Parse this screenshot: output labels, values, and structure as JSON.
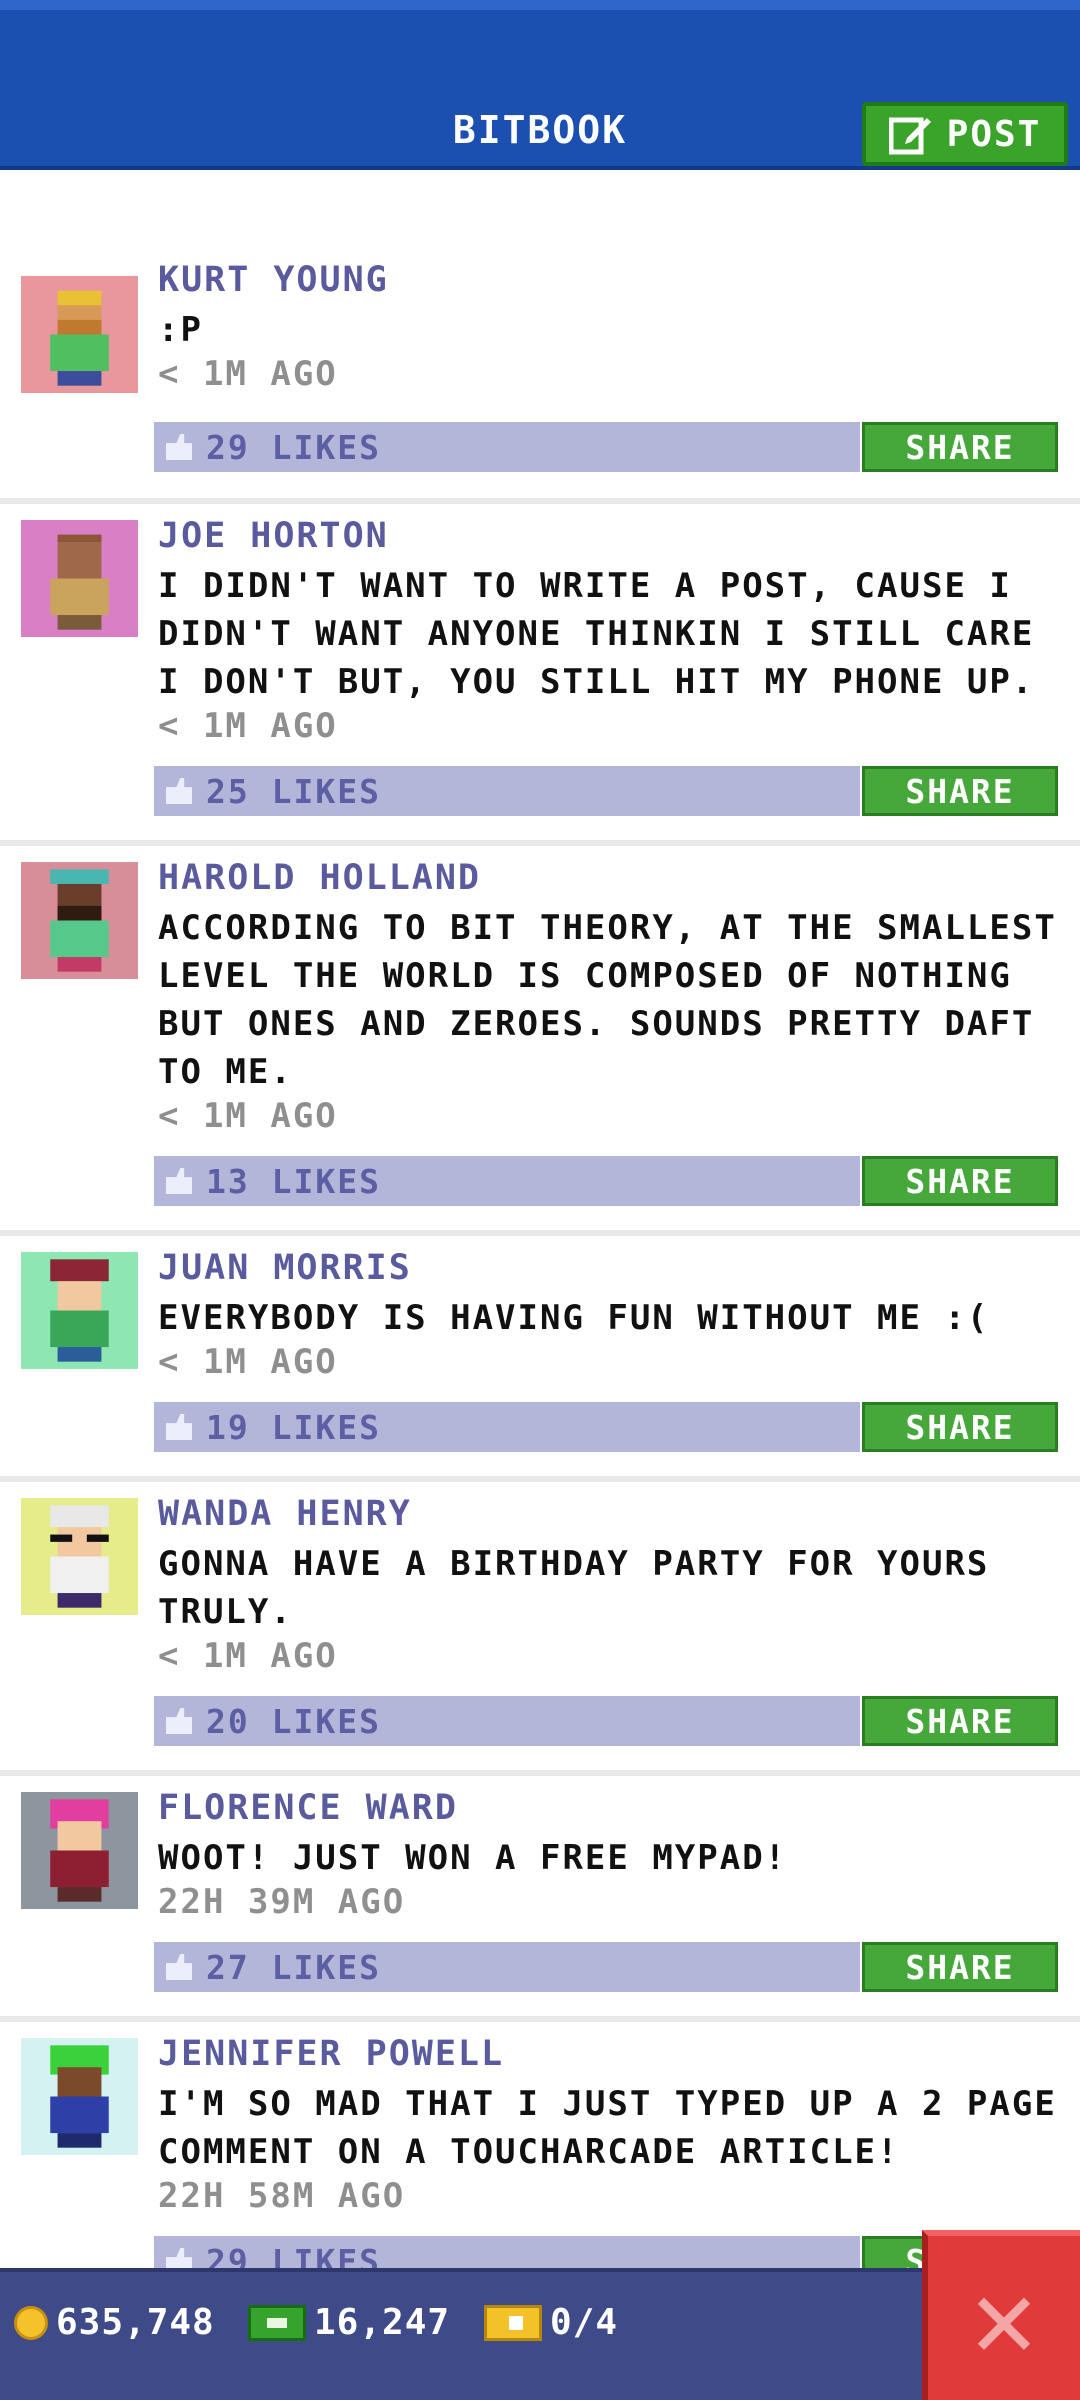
{
  "header": {
    "title": "BITBOOK",
    "post_label": "POST"
  },
  "posts": [
    {
      "name": "KURT YOUNG",
      "text": ":P",
      "time": "< 1M AGO",
      "likes": "29 LIKES",
      "share": "SHARE",
      "avatar_bg": "#e8979d"
    },
    {
      "name": "JOE HORTON",
      "text": "I DIDN'T WANT TO WRITE A POST, CAUSE I DIDN'T WANT ANYONE THINKIN I STILL CARE I DON'T BUT, YOU STILL HIT MY PHONE UP.",
      "time": "< 1M AGO",
      "likes": "25 LIKES",
      "share": "SHARE",
      "avatar_bg": "#d97fc6"
    },
    {
      "name": "HAROLD HOLLAND",
      "text": "ACCORDING TO BIT THEORY, AT THE SMALLEST LEVEL THE WORLD IS COMPOSED OF NOTHING BUT ONES AND ZEROES. SOUNDS PRETTY DAFT TO ME.",
      "time": "< 1M AGO",
      "likes": "13 LIKES",
      "share": "SHARE",
      "avatar_bg": "#d88e98"
    },
    {
      "name": "JUAN MORRIS",
      "text": "EVERYBODY IS HAVING FUN WITHOUT ME :(",
      "time": "< 1M AGO",
      "likes": "19 LIKES",
      "share": "SHARE",
      "avatar_bg": "#8ee6b2"
    },
    {
      "name": "WANDA HENRY",
      "text": "GONNA HAVE A BIRTHDAY PARTY FOR YOURS TRULY.",
      "time": "< 1M AGO",
      "likes": "20 LIKES",
      "share": "SHARE",
      "avatar_bg": "#e6ec8a"
    },
    {
      "name": "FLORENCE WARD",
      "text": "WOOT! JUST WON A FREE MYPAD!",
      "time": "22H 39M AGO",
      "likes": "27 LIKES",
      "share": "SHARE",
      "avatar_bg": "#8d969e"
    },
    {
      "name": "JENNIFER POWELL",
      "text": "I'M SO MAD THAT I JUST TYPED UP A 2 PAGE COMMENT ON A TOUCHARCADE ARTICLE!",
      "time": "22H 58M AGO",
      "likes": "29 LIKES",
      "share": "SHARE",
      "avatar_bg": "#d5f2f2"
    }
  ],
  "footer": {
    "coins": "635,748",
    "bux": "16,247",
    "tickets": "0/4"
  },
  "icons": {
    "post": "edit-icon",
    "like": "thumbs-up-icon",
    "coin": "coin-icon",
    "bux": "cash-icon",
    "ticket": "ticket-icon",
    "close": "close-icon"
  }
}
